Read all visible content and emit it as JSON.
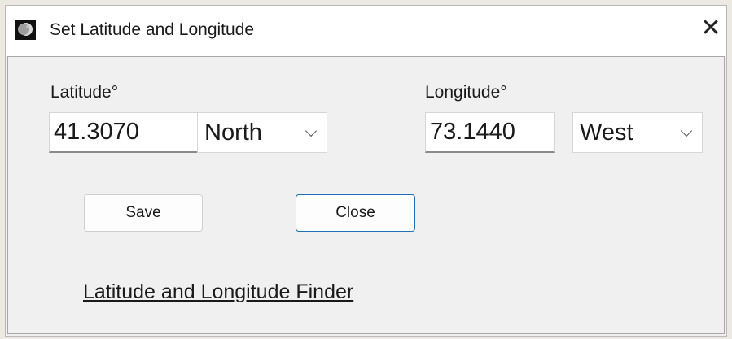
{
  "window": {
    "title": "Set Latitude and Longitude",
    "close_glyph": "✕",
    "app_icon": "moon-icon"
  },
  "latitude": {
    "label": "Latitude°",
    "value": "41.3070",
    "hemisphere": "North"
  },
  "longitude": {
    "label": "Longitude°",
    "value": "73.1440",
    "hemisphere": "West"
  },
  "buttons": {
    "save": "Save",
    "close": "Close"
  },
  "link": {
    "text": "Latitude and Longitude Finder"
  },
  "colors": {
    "accent": "#1d6fb8"
  }
}
